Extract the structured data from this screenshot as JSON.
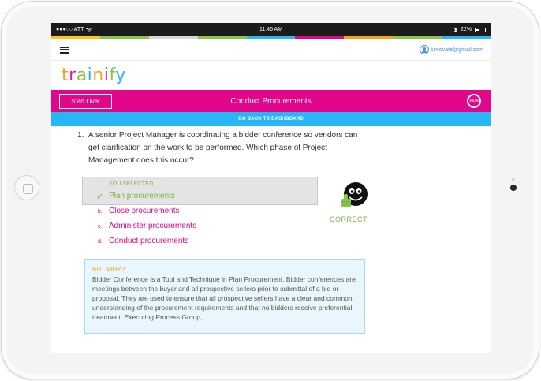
{
  "status_bar": {
    "carrier": "●●●○○ ATT",
    "time": "11:46 AM",
    "battery": "22%"
  },
  "color_strip": [
    "#ffc61a",
    "#8bc34a",
    "#d6d6d6",
    "#8bc34a",
    "#29b6f6",
    "#e2078a",
    "#f7a21b",
    "#8bc34a",
    "#29b6f6"
  ],
  "header": {
    "user_email": "simovate@gmail.com",
    "logo_letters": [
      "t",
      "r",
      "a",
      "i",
      "n",
      "i",
      "f",
      "y"
    ]
  },
  "title_bar": {
    "start_over_label": "Start Over",
    "title": "Conduct Procurements",
    "progress": "100%"
  },
  "dashboard_link": "GO BACK TO DASHBOARD",
  "question": {
    "number": "1.",
    "text": "A senior Project Manager is coordinating a bidder conference so vendors can get clarification on the work to be performed. Which phase of Project Management does this occur?"
  },
  "answer": {
    "selected_label": "YOU SELECTED",
    "check_glyph": "✓",
    "selected_option": "Plan procurements",
    "options": [
      {
        "letter": "b.",
        "text": "Close procurements"
      },
      {
        "letter": "c.",
        "text": "Administer procurements"
      },
      {
        "letter": "d.",
        "text": "Conduct procurements"
      }
    ],
    "result": "CORRECT"
  },
  "explanation": {
    "title": "BUT WHY?",
    "text": "Bidder Conference is a Tool and Technique in Plan Procurement. Bidder conferences are meetings between the buyer and all prospective sellers prior to submittal of a bid or proposal. They are used to ensure that all prospective sellers have a clear and common understanding of the procurement requirements and that no bidders receive preferential treatment. Executing Process Group,"
  },
  "icons": {
    "menu": "hamburger-icon",
    "user": "user-icon",
    "wifi": "wifi-icon",
    "bluetooth": "bluetooth-icon",
    "battery": "battery-icon",
    "result": "smiley-thumbs-up-icon",
    "check": "check-icon"
  },
  "colors": {
    "brand_pink": "#e2078a",
    "brand_blue": "#29b6f6",
    "correct_green": "#7cb342",
    "orange": "#f7a21b"
  }
}
